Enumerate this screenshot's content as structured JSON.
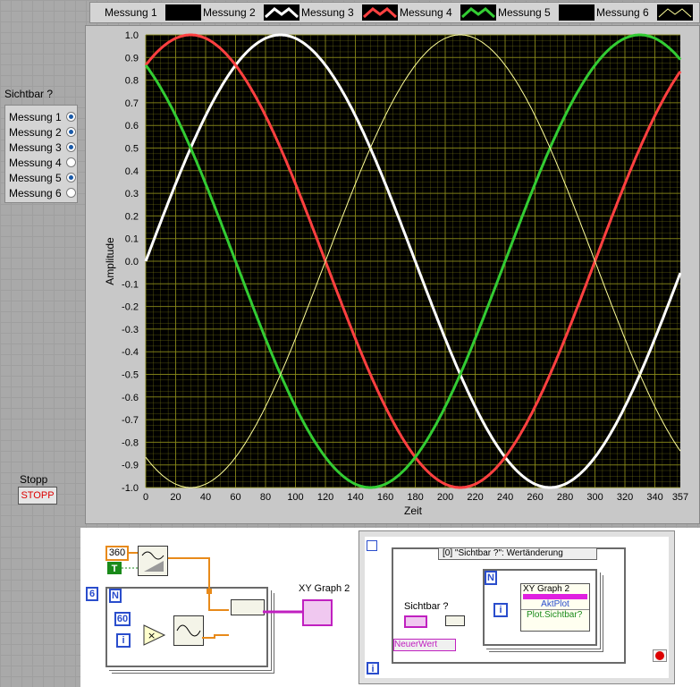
{
  "legend": {
    "items": [
      {
        "label": "Messung 1",
        "color": "#000000",
        "style": "block"
      },
      {
        "label": "Messung 2",
        "color": "#ffffff",
        "style": "thick"
      },
      {
        "label": "Messung 3",
        "color": "#ff4040",
        "style": "thick"
      },
      {
        "label": "Messung 4",
        "color": "#33cc33",
        "style": "thick"
      },
      {
        "label": "Messung 5",
        "color": "#000000",
        "style": "block"
      },
      {
        "label": "Messung 6",
        "color": "#ffff99",
        "style": "thin"
      }
    ]
  },
  "visibility": {
    "title": "Sichtbar ?",
    "items": [
      {
        "label": "Messung 1",
        "on": true
      },
      {
        "label": "Messung 2",
        "on": true
      },
      {
        "label": "Messung 3",
        "on": true
      },
      {
        "label": "Messung 4",
        "on": false
      },
      {
        "label": "Messung 5",
        "on": true
      },
      {
        "label": "Messung 6",
        "on": false
      }
    ]
  },
  "stop": {
    "title": "Stopp",
    "label": "STOPP"
  },
  "chart_data": {
    "type": "line",
    "xlabel": "Zeit",
    "ylabel": "Amplitude",
    "xlim": [
      0,
      357
    ],
    "ylim": [
      -1.0,
      1.0
    ],
    "xticks": [
      "0",
      "20",
      "40",
      "60",
      "80",
      "100",
      "120",
      "140",
      "160",
      "180",
      "200",
      "220",
      "240",
      "260",
      "280",
      "300",
      "320",
      "340",
      "357"
    ],
    "yticks": [
      "1.0",
      "0.9",
      "0.8",
      "0.7",
      "0.6",
      "0.5",
      "0.4",
      "0.3",
      "0.2",
      "0.1",
      "0.0",
      "-0.1",
      "-0.2",
      "-0.3",
      "-0.4",
      "-0.5",
      "-0.6",
      "-0.7",
      "-0.8",
      "-0.9",
      "-1.0"
    ],
    "grid": true,
    "background": "#000000",
    "grid_color": "#8a8a1a",
    "series": [
      {
        "name": "Messung 2",
        "color": "#ffffff",
        "width": 3,
        "phase_deg": 0
      },
      {
        "name": "Messung 3",
        "color": "#ff4040",
        "width": 3,
        "phase_deg": 60
      },
      {
        "name": "Messung 4",
        "color": "#33cc33",
        "width": 3,
        "phase_deg": 120
      },
      {
        "name": "Messung 6",
        "color": "#ffff99",
        "width": 1,
        "phase_deg": 240
      }
    ]
  },
  "block_diagram": {
    "const_360": "360",
    "const_6": "6",
    "const_60": "60",
    "loop_count_label": "N",
    "iter_label": "i",
    "bool_const": "T",
    "graph_terminal_label": "XY Graph 2",
    "event_case_label": "[0] \"Sichtbar ?\": Wertänderung",
    "event_source_label": "Sichtbar ?",
    "neuer_wert_label": "NeuerWert",
    "prop_node_title": "XY Graph 2",
    "prop_aktplot": "AktPlot",
    "prop_sichtbar": "Plot.Sichtbar?"
  }
}
